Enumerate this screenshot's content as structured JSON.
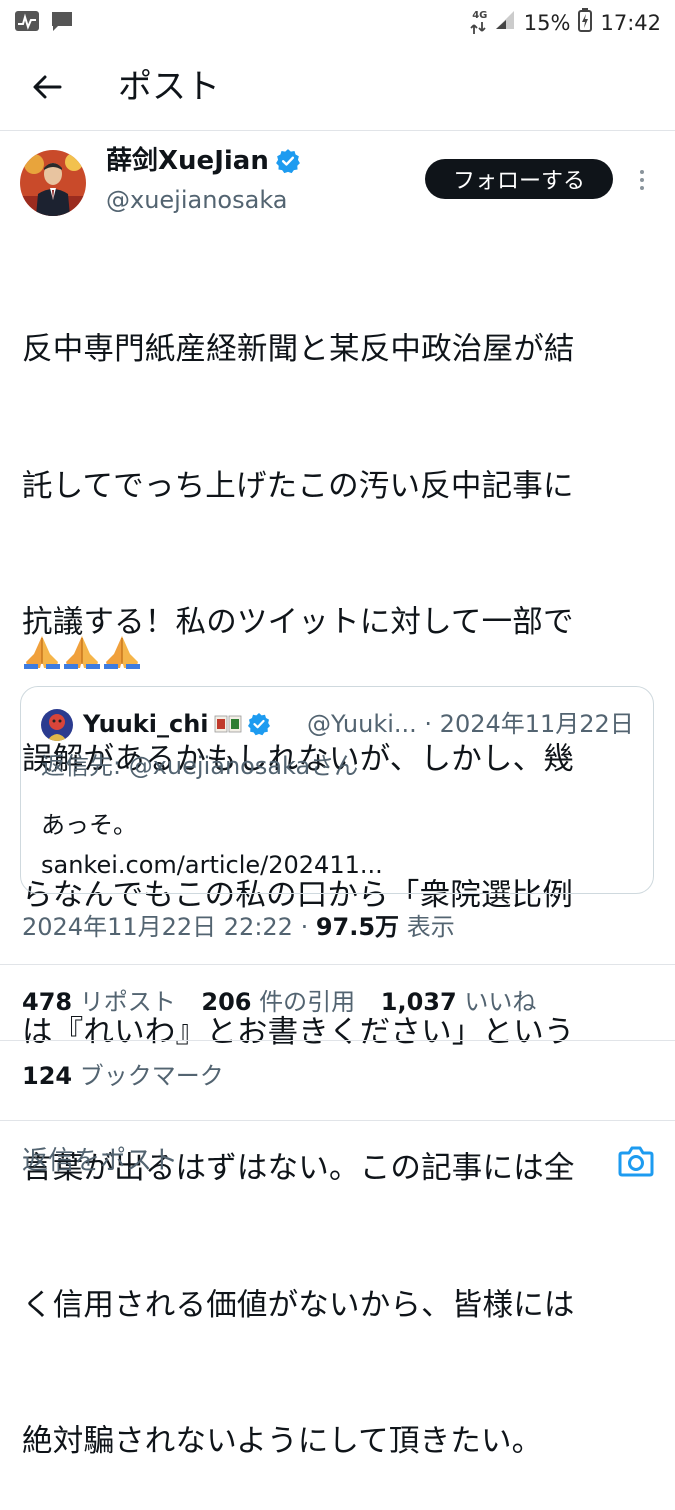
{
  "status_bar": {
    "network": "4G",
    "battery": "15%",
    "time": "17:42",
    "icons": [
      "activity-icon",
      "message-icon",
      "wifi-signal-icon",
      "cell-signal-icon",
      "battery-icon"
    ]
  },
  "header": {
    "title": "ポスト",
    "back_icon": "back-arrow-icon"
  },
  "author": {
    "display_name": "薛剑XueJian",
    "handle": "@xuejianosaka",
    "verified_icon": "verified-badge-icon",
    "follow_label": "フォローする",
    "more_icon": "more-vertical-icon"
  },
  "post": {
    "text_lines": [
      "反中専門紙産経新聞と某反中政治屋が結",
      "託してでっち上げたこの汚い反中記事に",
      "抗議する！私のツイットに対して一部で",
      "誤解があるかもしれないが、しかし、幾",
      "らなんでもこの私の口から「衆院選比例",
      "は『れいわ』とお書きください」という",
      "言葉が出るはずはない。この記事には全",
      "く信用される価値がないから、皆様には",
      "絶対騙されないようにして頂きたい。"
    ],
    "emoji": [
      "🙏",
      "🙏",
      "🙏"
    ],
    "timestamp": "2024年11月22日 22:22",
    "separator": " · ",
    "views": "97.5万",
    "views_label": " 表示"
  },
  "quoted": {
    "display_name": "Yuuki_chi",
    "handle": "@Yuuki...",
    "date": "2024年11月22日",
    "meta_separator": " · ",
    "reply_prefix": "返信先: ",
    "reply_target": "@xuejianosaka",
    "reply_suffix": "さん",
    "text": "あっそ。",
    "link": "sankei.com/article/202411..."
  },
  "stats": {
    "reposts": "478",
    "reposts_label": "リポスト",
    "quotes": "206",
    "quotes_label": "件の引用",
    "likes": "1,037",
    "likes_label": "いいね",
    "bookmarks": "124",
    "bookmarks_label": "ブックマーク"
  },
  "reply": {
    "placeholder": "返信をポスト",
    "camera_icon": "camera-icon"
  },
  "colors": {
    "text": "#0f1419",
    "secondary": "#536471",
    "accent": "#1d9bf0",
    "divider": "#e1e4e8"
  }
}
